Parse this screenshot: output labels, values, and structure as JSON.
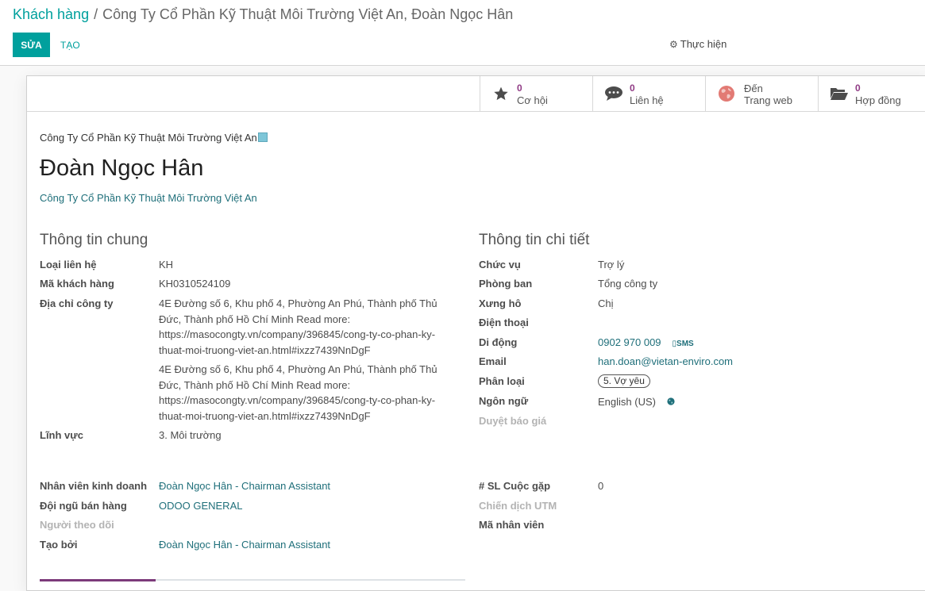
{
  "breadcrumb": {
    "root": "Khách hàng",
    "separator": "/",
    "current": "Công Ty Cổ Phần Kỹ Thuật Môi Trường Việt An, Đoàn Ngọc Hân"
  },
  "toolbar": {
    "edit_label": "SỬA",
    "create_label": "TẠO",
    "action_label": "Thực hiện"
  },
  "stat_buttons": [
    {
      "icon": "star-icon",
      "count": "0",
      "label": "Cơ hội"
    },
    {
      "icon": "comments-icon",
      "count": "0",
      "label": "Liên hệ"
    },
    {
      "icon": "globe-icon",
      "count": "Đến",
      "label": "Trang web"
    },
    {
      "icon": "folder-open-icon",
      "count": "0",
      "label": "Hợp đồng"
    }
  ],
  "header": {
    "company_line": "Công Ty Cổ Phần Kỹ Thuật Môi Trường Việt An",
    "name": "Đoàn Ngọc Hân",
    "company_link": "Công Ty Cổ Phần Kỹ Thuật Môi Trường Việt An"
  },
  "general": {
    "title": "Thông tin chung",
    "contact_type_label": "Loại liên hệ",
    "contact_type_value": "KH",
    "customer_code_label": "Mã khách hàng",
    "customer_code_value": "KH0310524109",
    "address_label": "Địa chỉ công ty",
    "address_value_1": "4E Đường số 6, Khu phố 4, Phường An Phú, Thành phố Thủ Đức, Thành phố Hồ Chí Minh Read more: https://masocongty.vn/company/396845/cong-ty-co-phan-ky-thuat-moi-truong-viet-an.html#ixzz7439NnDgF",
    "address_value_2": "4E Đường số 6, Khu phố 4, Phường An Phú, Thành phố Thủ Đức, Thành phố Hồ Chí Minh Read more: https://masocongty.vn/company/396845/cong-ty-co-phan-ky-thuat-moi-truong-viet-an.html#ixzz7439NnDgF",
    "industry_label": "Lĩnh vực",
    "industry_value": "3. Môi trường",
    "salesperson_label": "Nhân viên kinh doanh",
    "salesperson_value": "Đoàn Ngọc Hân - Chairman Assistant",
    "sales_team_label": "Đội ngũ bán hàng",
    "sales_team_value": "ODOO GENERAL",
    "followers_label": "Người theo dõi",
    "created_by_label": "Tạo bởi",
    "created_by_value": "Đoàn Ngọc Hân - Chairman Assistant"
  },
  "details": {
    "title": "Thông tin chi tiết",
    "job_label": "Chức vụ",
    "job_value": "Trợ lý",
    "department_label": "Phòng ban",
    "department_value": "Tổng công ty",
    "title_label": "Xưng hô",
    "title_value": "Chị",
    "phone_label": "Điện thoại",
    "mobile_label": "Di động",
    "mobile_value": "0902 970 009",
    "sms_label": "SMS",
    "email_label": "Email",
    "email_value": "han.doan@vietan-enviro.com",
    "category_label": "Phân loại",
    "category_value": "5. Vợ yêu",
    "language_label": "Ngôn ngữ",
    "language_value": "English (US)",
    "quote_approval_label": "Duyệt báo giá",
    "meeting_count_label": "# SL Cuộc gặp",
    "meeting_count_value": "0",
    "utm_campaign_label": "Chiến dịch UTM",
    "employee_code_label": "Mã nhân viên"
  },
  "colors": {
    "primary": "#00a09d",
    "stat_number": "#8f3a84",
    "link": "#1f6f7a"
  }
}
